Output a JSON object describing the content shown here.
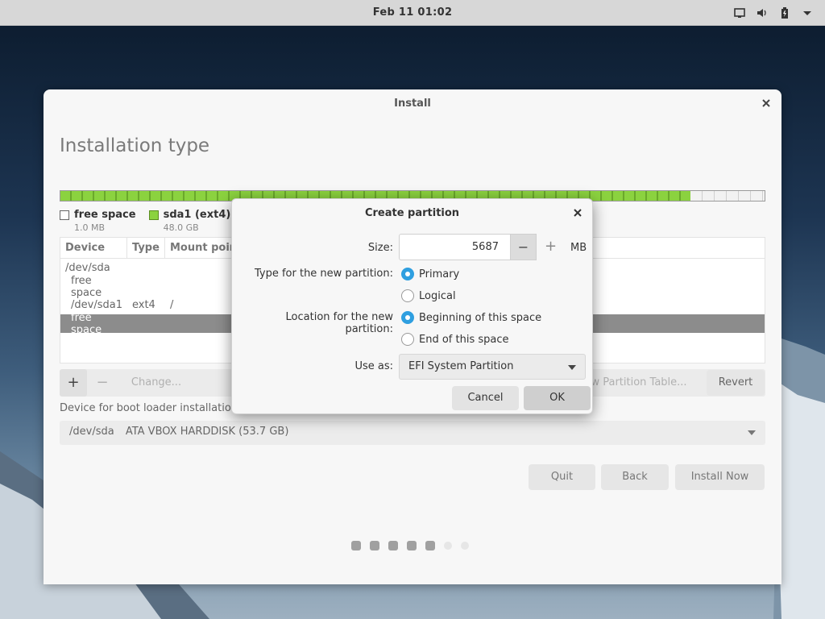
{
  "topbar": {
    "clock": "Feb 11  01:02",
    "tray_icons": [
      "screen-icon",
      "volume-icon",
      "battery-icon",
      "menu-arrow-icon"
    ]
  },
  "window": {
    "title": "Install",
    "heading": "Installation type",
    "partition_bar": {
      "segments": [
        {
          "name": "free space",
          "size": "1.0 MB",
          "color": "#ffffff"
        },
        {
          "name": "sda1 (ext4)",
          "size": "48.0 GB",
          "color": "#8bd23f"
        }
      ]
    },
    "table": {
      "headers": [
        "Device",
        "Type",
        "Mount point"
      ],
      "rows": [
        {
          "device": "/dev/sda",
          "type": "",
          "mount": ""
        },
        {
          "device": "free space",
          "type": "",
          "mount": ""
        },
        {
          "device": "/dev/sda1",
          "type": "ext4",
          "mount": "/"
        },
        {
          "device": "free space",
          "type": "",
          "mount": "",
          "selected": true
        }
      ]
    },
    "tools": {
      "add": "+",
      "remove": "−",
      "change": "Change...",
      "new_table": "ew Partition Table...",
      "revert": "Revert"
    },
    "bootloader": {
      "label": "Device for boot loader installation:",
      "device": "/dev/sda",
      "description": "ATA VBOX HARDDISK (53.7 GB)"
    },
    "buttons": {
      "quit": "Quit",
      "back": "Back",
      "install": "Install Now"
    },
    "progress": {
      "done": 5,
      "total": 7
    }
  },
  "dialog": {
    "title": "Create partition",
    "size_label": "Size:",
    "size_value": "5687",
    "minus": "−",
    "plus": "+",
    "unit": "MB",
    "type_label": "Type for the new partition:",
    "type_primary": "Primary",
    "type_logical": "Logical",
    "location_label": "Location for the new partition:",
    "loc_begin": "Beginning of this space",
    "loc_end": "End of this space",
    "use_label": "Use as:",
    "use_value": "EFI System Partition",
    "cancel": "Cancel",
    "ok": "OK",
    "accent": "#2f9fe0"
  }
}
